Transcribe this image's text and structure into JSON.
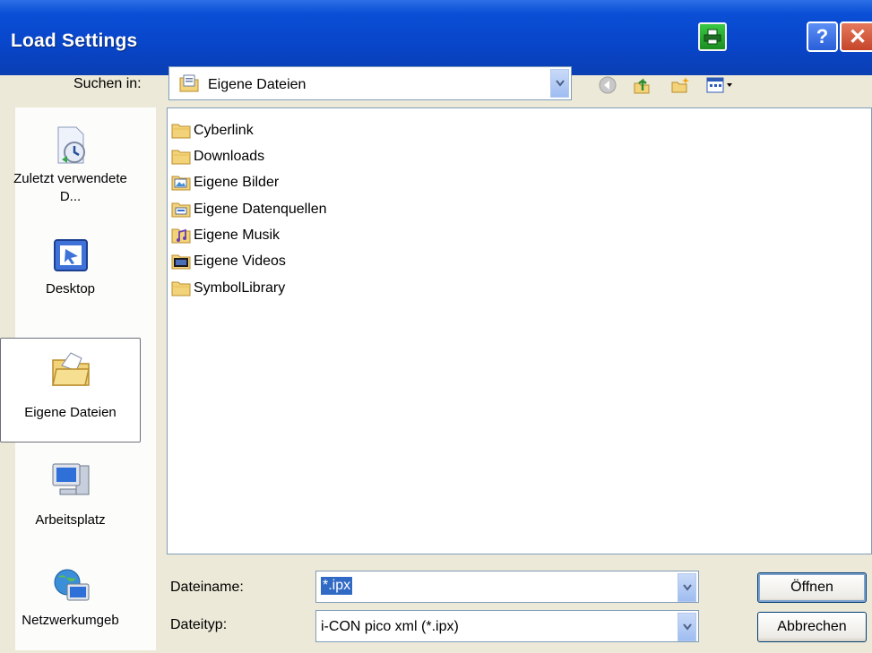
{
  "window": {
    "title": "Load Settings"
  },
  "lookin": {
    "label": "Suchen in:",
    "value": "Eigene Dateien"
  },
  "places": [
    {
      "label": "Zuletzt verwendete D...",
      "icon": "recent-documents-icon"
    },
    {
      "label": "Desktop",
      "icon": "desktop-icon"
    },
    {
      "label": "Eigene Dateien",
      "icon": "my-documents-icon",
      "selected": true
    },
    {
      "label": "Arbeitsplatz",
      "icon": "my-computer-icon"
    },
    {
      "label": "Netzwerkumgeb",
      "icon": "network-icon"
    }
  ],
  "files": [
    {
      "name": "Cyberlink",
      "icon": "folder-icon"
    },
    {
      "name": "Downloads",
      "icon": "folder-icon"
    },
    {
      "name": "Eigene Bilder",
      "icon": "pictures-folder-icon"
    },
    {
      "name": "Eigene Datenquellen",
      "icon": "datasource-folder-icon"
    },
    {
      "name": "Eigene Musik",
      "icon": "music-folder-icon"
    },
    {
      "name": "Eigene Videos",
      "icon": "videos-folder-icon"
    },
    {
      "name": "SymbolLibrary",
      "icon": "folder-icon"
    }
  ],
  "filename": {
    "label": "Dateiname:",
    "value": "*.ipx"
  },
  "filetype": {
    "label": "Dateityp:",
    "value": "i-CON pico xml (*.ipx)"
  },
  "buttons": {
    "open": "Öffnen",
    "cancel": "Abbrechen"
  },
  "titlebar_buttons": {
    "help": "?",
    "close": "✕"
  }
}
